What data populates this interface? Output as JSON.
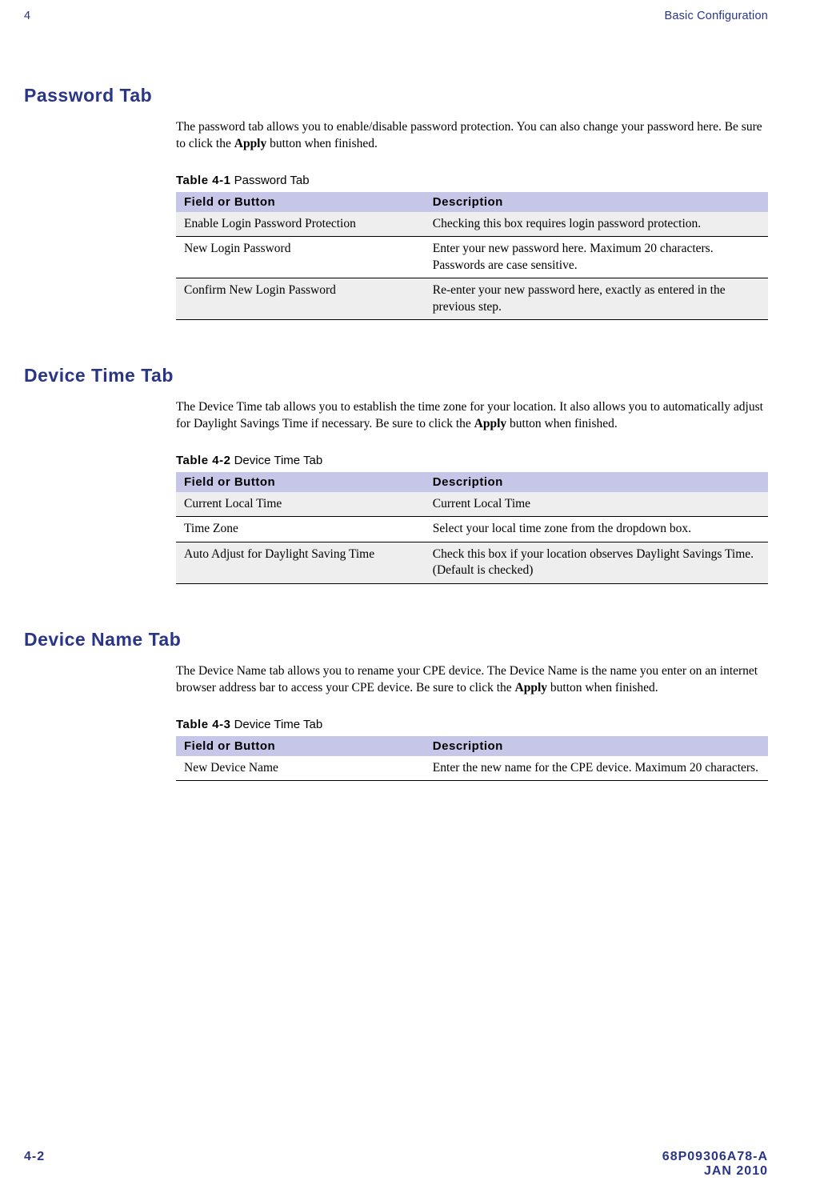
{
  "header": {
    "chapter_num": "4",
    "chapter_title": "Basic Configuration"
  },
  "sections": [
    {
      "heading": "Password Tab",
      "para_pre": "The password tab allows you to enable/disable password protection. You can also change your password here. Be sure to click the ",
      "para_bold": "Apply",
      "para_post": " button when finished.",
      "table_caption_prefix": "Table 4-1",
      "table_caption_title": "Password Tab",
      "col1": "Field or Button",
      "col2": "Description",
      "rows": [
        {
          "field": "Enable Login Password Protection",
          "desc": "Checking this box requires login password protection."
        },
        {
          "field": "New Login Password",
          "desc": "Enter your new password here. Maximum 20 characters. Passwords are case sensitive."
        },
        {
          "field": "Confirm New Login Password",
          "desc": "Re-enter your new password here, exactly as entered in the previous step."
        }
      ]
    },
    {
      "heading": "Device Time Tab",
      "para_pre": "The Device Time tab allows you to establish the time zone for your location. It also allows you to automatically adjust for Daylight Savings Time if necessary. Be sure to click the ",
      "para_bold": "Apply",
      "para_post": " button when finished.",
      "table_caption_prefix": "Table 4-2",
      "table_caption_title": "Device Time Tab",
      "col1": "Field or Button",
      "col2": "Description",
      "rows": [
        {
          "field": "Current Local Time",
          "desc": "Current Local Time"
        },
        {
          "field": "Time Zone",
          "desc": "Select your local time zone from the dropdown box."
        },
        {
          "field": "Auto Adjust for Daylight Saving Time",
          "desc": "Check this box if your location observes Daylight Savings Time. (Default is checked)"
        }
      ]
    },
    {
      "heading": "Device Name Tab",
      "para_pre": "The Device Name tab allows you to rename your CPE device. The Device Name is the name you enter on an internet browser address bar to access your CPE device. Be sure to click the ",
      "para_bold": "Apply",
      "para_post": " button when finished.",
      "table_caption_prefix": "Table 4-3",
      "table_caption_title": "Device Time Tab",
      "col1": "Field or Button",
      "col2": "Description",
      "rows": [
        {
          "field": "New Device Name",
          "desc": "Enter the new name for the CPE device. Maximum 20 characters."
        }
      ]
    }
  ],
  "footer": {
    "page": "4-2",
    "docnum": "68P09306A78-A",
    "date": "JAN 2010"
  }
}
